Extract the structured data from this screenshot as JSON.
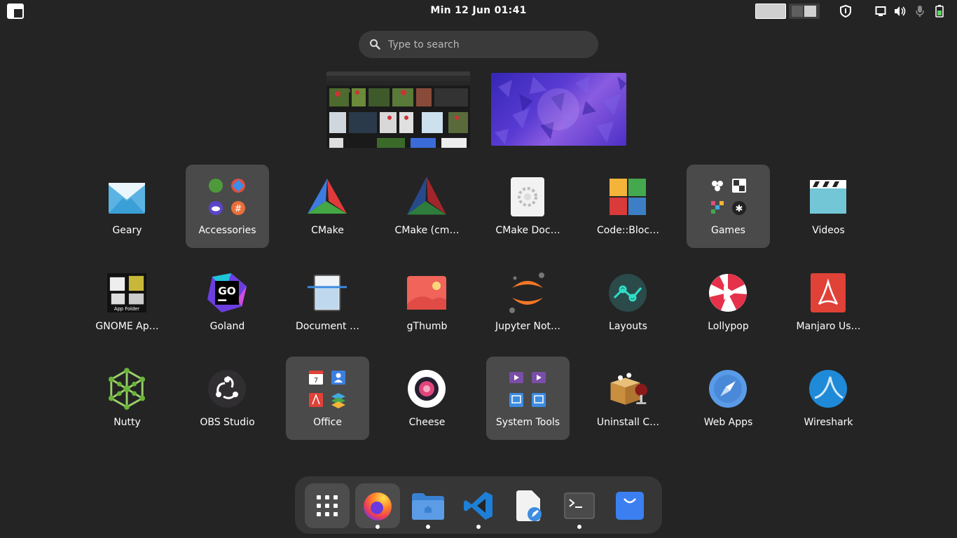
{
  "topbar": {
    "clock": "Min 12 Jun  01:41"
  },
  "search": {
    "placeholder": "Type to search"
  },
  "apps": [
    {
      "label": "Geary",
      "icon": "geary-icon"
    },
    {
      "label": "Accessories",
      "icon": "accessories-folder-icon"
    },
    {
      "label": "CMake",
      "icon": "cmake-icon"
    },
    {
      "label": "CMake (cm…",
      "icon": "cmake-curses-icon"
    },
    {
      "label": "CMake Doc…",
      "icon": "cmake-doc-icon"
    },
    {
      "label": "Code::Bloc…",
      "icon": "codeblocks-icon"
    },
    {
      "label": "Games",
      "icon": "games-folder-icon"
    },
    {
      "label": "Videos",
      "icon": "videos-icon"
    },
    {
      "label": "GNOME Ap…",
      "icon": "app-folder-icon"
    },
    {
      "label": "Goland",
      "icon": "goland-icon"
    },
    {
      "label": "Document …",
      "icon": "document-scanner-icon"
    },
    {
      "label": "gThumb",
      "icon": "gthumb-icon"
    },
    {
      "label": "Jupyter Not…",
      "icon": "jupyter-icon"
    },
    {
      "label": "Layouts",
      "icon": "layouts-icon"
    },
    {
      "label": "Lollypop",
      "icon": "lollypop-icon"
    },
    {
      "label": "Manjaro Us…",
      "icon": "manjaro-user-guide-icon"
    },
    {
      "label": "Nutty",
      "icon": "nutty-icon"
    },
    {
      "label": "OBS Studio",
      "icon": "obs-icon"
    },
    {
      "label": "Office",
      "icon": "office-folder-icon"
    },
    {
      "label": "Cheese",
      "icon": "cheese-icon"
    },
    {
      "label": "System Tools",
      "icon": "system-tools-folder-icon"
    },
    {
      "label": "Uninstall C…",
      "icon": "uninstall-icon"
    },
    {
      "label": "Web Apps",
      "icon": "web-apps-icon"
    },
    {
      "label": "Wireshark",
      "icon": "wireshark-icon"
    }
  ],
  "gnome_app_folder_caption": "App Folder",
  "goland_badge": "GO",
  "office_calendar_day": "7",
  "dock": [
    {
      "name": "show-apps",
      "running": false
    },
    {
      "name": "firefox",
      "running": true
    },
    {
      "name": "files",
      "running": true
    },
    {
      "name": "vscode",
      "running": true
    },
    {
      "name": "text-editor",
      "running": false
    },
    {
      "name": "terminal",
      "running": true
    },
    {
      "name": "software",
      "running": false
    }
  ]
}
